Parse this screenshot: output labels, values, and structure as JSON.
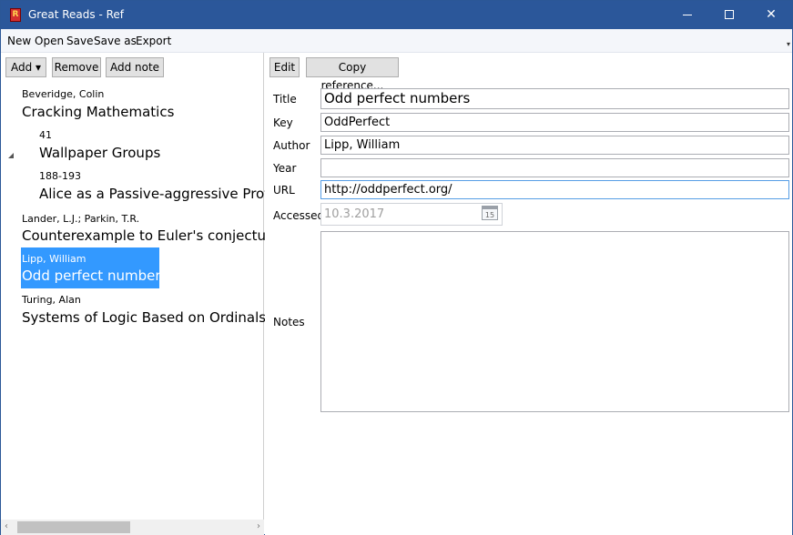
{
  "window": {
    "title": "Great Reads - Ref",
    "icon": "app-bookmark-icon",
    "controls": {
      "minimize": "minimize-icon",
      "maximize": "maximize-icon",
      "close": "✕"
    }
  },
  "menu": {
    "items": [
      "New",
      "Open",
      "Save",
      "Save as",
      "Export"
    ],
    "overflow": "▾"
  },
  "left_toolbar": {
    "add": "Add ▾",
    "remove": "Remove",
    "add_note": "Add note"
  },
  "tree": {
    "expander": "expanded-triangle-icon",
    "items": [
      {
        "author": "Beveridge, Colin",
        "title": "Cracking Mathematics"
      },
      {
        "author": "41",
        "title": "Wallpaper Groups"
      },
      {
        "author": "188-193",
        "title": "Alice as a Passive-aggressive Protes"
      },
      {
        "author": "Lander, L.J.; Parkin, T.R.",
        "title": "Counterexample to Euler's conjecture"
      },
      {
        "author": "Lipp, William",
        "title": "Odd perfect numbers"
      },
      {
        "author": "Turing, Alan",
        "title": "Systems of Logic Based on Ordinals"
      }
    ],
    "selected_index": 4
  },
  "scrollbar": {
    "left_arrow": "‹",
    "right_arrow": "›"
  },
  "right_toolbar": {
    "edit": "Edit",
    "copy_reference": "Copy reference..."
  },
  "form": {
    "title_label": "Title",
    "title_value": "Odd perfect numbers",
    "key_label": "Key",
    "key_value": "OddPerfect",
    "author_label": "Author",
    "author_value": "Lipp, William",
    "year_label": "Year",
    "year_value": "",
    "url_label": "URL",
    "url_value": "http://oddperfect.org/",
    "accessed_label": "Accessed",
    "accessed_value": "10.3.2017",
    "calendar_day": "15",
    "notes_label": "Notes",
    "notes_value": ""
  }
}
